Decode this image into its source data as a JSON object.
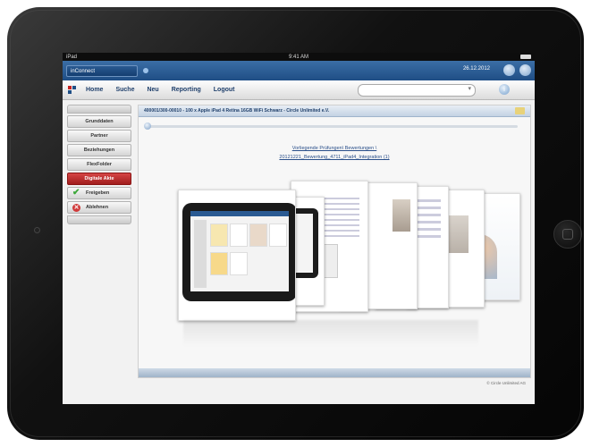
{
  "status_bar": {
    "carrier": "iPad",
    "time": "9:41 AM"
  },
  "header": {
    "app_selector": "inConnect",
    "date": "26.12.2012"
  },
  "menu": {
    "items": [
      "Home",
      "Suche",
      "Neu",
      "Reporting",
      "Logout"
    ],
    "search_placeholder": ""
  },
  "sidebar": {
    "items": [
      {
        "label": "Grunddaten",
        "active": false
      },
      {
        "label": "Partner",
        "active": false
      },
      {
        "label": "Beziehungen",
        "active": false
      },
      {
        "label": "FlexFolder",
        "active": false
      },
      {
        "label": "Digitale Akte",
        "active": true
      },
      {
        "label": "Freigeben",
        "active": false,
        "icon": "check-icon"
      },
      {
        "label": "Ablehnen",
        "active": false,
        "icon": "reject-icon"
      }
    ]
  },
  "main": {
    "title": "400001/300-00010 - 100 x Apple iPad 4 Retina 16GB WiFi Schwarz - Circle Unlimited e.V.",
    "doc_link_line1": "Vorliegende Prüfungen\\ Bewertungen \\",
    "doc_link_line2": "20121221_Bewertung_4711_iPad4_Integration (1)",
    "copyright": "© Circle Unlimited AG"
  },
  "colors": {
    "accent_blue": "#1f4e85",
    "active_red": "#b52626",
    "link": "#2a4f8a"
  }
}
